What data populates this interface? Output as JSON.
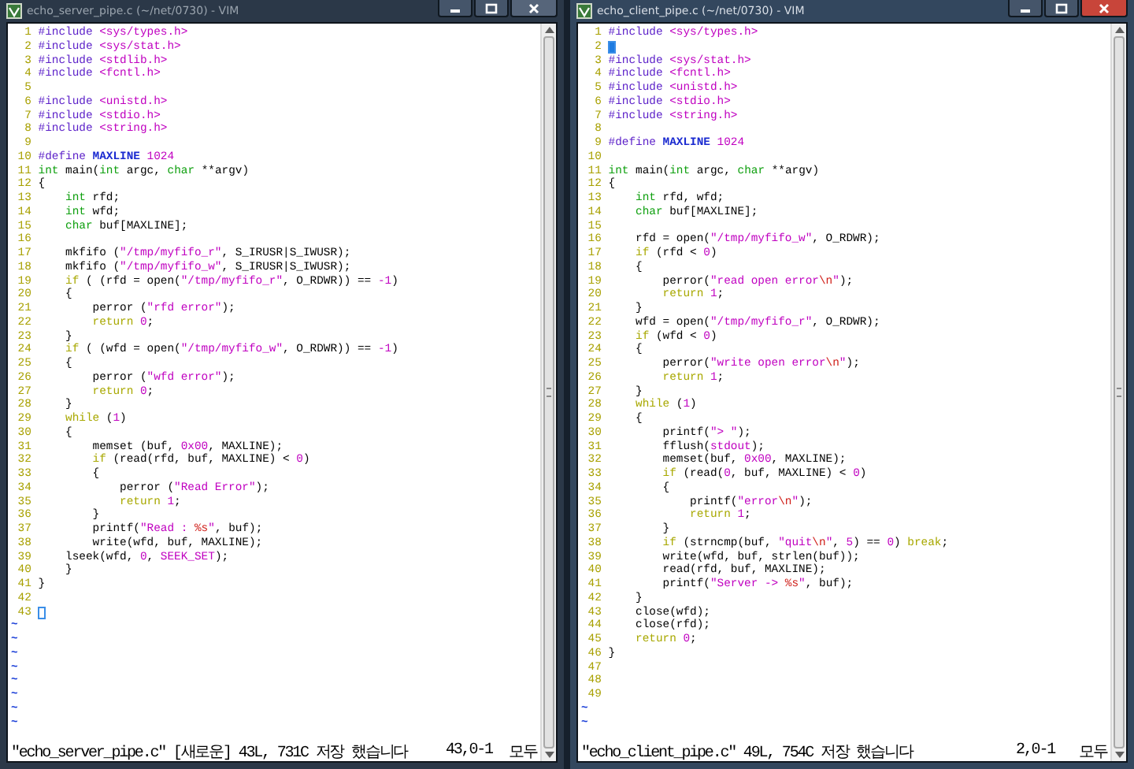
{
  "windows": [
    {
      "title": "echo_server_pipe.c (~/net/0730) - VIM",
      "active": false,
      "lines": [
        {
          "number": "1",
          "cursor": false,
          "tokens": [
            {
              "kind": "pre",
              "text": "#include "
            },
            {
              "kind": "inc",
              "text": "<sys/types.h>"
            }
          ]
        },
        {
          "number": "2",
          "cursor": false,
          "tokens": [
            {
              "kind": "pre",
              "text": "#include "
            },
            {
              "kind": "inc",
              "text": "<sys/stat.h>"
            }
          ]
        },
        {
          "number": "3",
          "cursor": false,
          "tokens": [
            {
              "kind": "pre",
              "text": "#include "
            },
            {
              "kind": "inc",
              "text": "<stdlib.h>"
            }
          ]
        },
        {
          "number": "4",
          "cursor": false,
          "tokens": [
            {
              "kind": "pre",
              "text": "#include "
            },
            {
              "kind": "inc",
              "text": "<fcntl.h>"
            }
          ]
        },
        {
          "number": "5",
          "cursor": false
        },
        {
          "number": "6",
          "cursor": false,
          "tokens": [
            {
              "kind": "pre",
              "text": "#include "
            },
            {
              "kind": "inc",
              "text": "<unistd.h>"
            }
          ]
        },
        {
          "number": "7",
          "cursor": false,
          "tokens": [
            {
              "kind": "pre",
              "text": "#include "
            },
            {
              "kind": "inc",
              "text": "<stdio.h>"
            }
          ]
        },
        {
          "number": "8",
          "cursor": false,
          "tokens": [
            {
              "kind": "pre",
              "text": "#include "
            },
            {
              "kind": "inc",
              "text": "<string.h>"
            }
          ]
        },
        {
          "number": "9",
          "cursor": false
        },
        {
          "number": "10",
          "cursor": false,
          "tokens": [
            {
              "kind": "pre",
              "text": "#define"
            },
            {
              "kind": "def",
              "text": " MAXLINE "
            },
            {
              "kind": "num",
              "text": "1024"
            }
          ]
        },
        {
          "number": "11",
          "cursor": false,
          "tokens": [
            {
              "kind": "type",
              "text": "int"
            },
            {
              "kind": "plain",
              "text": " main("
            },
            {
              "kind": "type",
              "text": "int"
            },
            {
              "kind": "plain",
              "text": " argc, "
            },
            {
              "kind": "type",
              "text": "char"
            },
            {
              "kind": "plain",
              "text": " **argv)"
            }
          ]
        },
        {
          "number": "12",
          "cursor": false,
          "tokens": [
            {
              "kind": "plain",
              "text": "{"
            }
          ]
        },
        {
          "number": "13",
          "cursor": false,
          "tokens": [
            {
              "kind": "type",
              "text": "    int"
            },
            {
              "kind": "plain",
              "text": " rfd;"
            }
          ]
        },
        {
          "number": "14",
          "cursor": false,
          "tokens": [
            {
              "kind": "type",
              "text": "    int"
            },
            {
              "kind": "plain",
              "text": " wfd;"
            }
          ]
        },
        {
          "number": "15",
          "cursor": false,
          "tokens": [
            {
              "kind": "type",
              "text": "    char"
            },
            {
              "kind": "plain",
              "text": " buf[MAXLINE];"
            }
          ]
        },
        {
          "number": "16",
          "cursor": false
        },
        {
          "number": "17",
          "cursor": false,
          "tokens": [
            {
              "kind": "plain",
              "text": "    mkfifo ("
            },
            {
              "kind": "str",
              "text": "\"/tmp/myfifo_r\""
            },
            {
              "kind": "plain",
              "text": ", S_IRUSR|S_IWUSR);"
            }
          ]
        },
        {
          "number": "18",
          "cursor": false,
          "tokens": [
            {
              "kind": "plain",
              "text": "    mkfifo ("
            },
            {
              "kind": "str",
              "text": "\"/tmp/myfifo_w\""
            },
            {
              "kind": "plain",
              "text": ", S_IRUSR|S_IWUSR);"
            }
          ]
        },
        {
          "number": "19",
          "cursor": false,
          "tokens": [
            {
              "kind": "stmt",
              "text": "    if"
            },
            {
              "kind": "plain",
              "text": " ( (rfd = open("
            },
            {
              "kind": "str",
              "text": "\"/tmp/myfifo_r\""
            },
            {
              "kind": "plain",
              "text": ", O_RDWR)) == "
            },
            {
              "kind": "num",
              "text": "-1"
            },
            {
              "kind": "plain",
              "text": ")"
            }
          ]
        },
        {
          "number": "20",
          "cursor": false,
          "tokens": [
            {
              "kind": "plain",
              "text": "    {"
            }
          ]
        },
        {
          "number": "21",
          "cursor": false,
          "tokens": [
            {
              "kind": "plain",
              "text": "        perror ("
            },
            {
              "kind": "str",
              "text": "\"rfd error\""
            },
            {
              "kind": "plain",
              "text": ");"
            }
          ]
        },
        {
          "number": "22",
          "cursor": false,
          "tokens": [
            {
              "kind": "stmt",
              "text": "        return "
            },
            {
              "kind": "num",
              "text": "0"
            },
            {
              "kind": "plain",
              "text": ";"
            }
          ]
        },
        {
          "number": "23",
          "cursor": false,
          "tokens": [
            {
              "kind": "plain",
              "text": "    }"
            }
          ]
        },
        {
          "number": "24",
          "cursor": false,
          "tokens": [
            {
              "kind": "stmt",
              "text": "    if"
            },
            {
              "kind": "plain",
              "text": " ( (wfd = open("
            },
            {
              "kind": "str",
              "text": "\"/tmp/myfifo_w\""
            },
            {
              "kind": "plain",
              "text": ", O_RDWR)) == "
            },
            {
              "kind": "num",
              "text": "-1"
            },
            {
              "kind": "plain",
              "text": ")"
            }
          ]
        },
        {
          "number": "25",
          "cursor": false,
          "tokens": [
            {
              "kind": "plain",
              "text": "    {"
            }
          ]
        },
        {
          "number": "26",
          "cursor": false,
          "tokens": [
            {
              "kind": "plain",
              "text": "        perror ("
            },
            {
              "kind": "str",
              "text": "\"wfd error\""
            },
            {
              "kind": "plain",
              "text": ");"
            }
          ]
        },
        {
          "number": "27",
          "cursor": false,
          "tokens": [
            {
              "kind": "stmt",
              "text": "        return "
            },
            {
              "kind": "num",
              "text": "0"
            },
            {
              "kind": "plain",
              "text": ";"
            }
          ]
        },
        {
          "number": "28",
          "cursor": false,
          "tokens": [
            {
              "kind": "plain",
              "text": "    }"
            }
          ]
        },
        {
          "number": "29",
          "cursor": false,
          "tokens": [
            {
              "kind": "stmt",
              "text": "    while"
            },
            {
              "kind": "plain",
              "text": " ("
            },
            {
              "kind": "num",
              "text": "1"
            },
            {
              "kind": "plain",
              "text": ")"
            }
          ]
        },
        {
          "number": "30",
          "cursor": false,
          "tokens": [
            {
              "kind": "plain",
              "text": "    {"
            }
          ]
        },
        {
          "number": "31",
          "cursor": false,
          "tokens": [
            {
              "kind": "plain",
              "text": "        memset (buf, "
            },
            {
              "kind": "num",
              "text": "0x00"
            },
            {
              "kind": "plain",
              "text": ", MAXLINE);"
            }
          ]
        },
        {
          "number": "32",
          "cursor": false,
          "tokens": [
            {
              "kind": "stmt",
              "text": "        if"
            },
            {
              "kind": "plain",
              "text": " (read(rfd, buf, MAXLINE) < "
            },
            {
              "kind": "num",
              "text": "0"
            },
            {
              "kind": "plain",
              "text": ")"
            }
          ]
        },
        {
          "number": "33",
          "cursor": false,
          "tokens": [
            {
              "kind": "plain",
              "text": "        {"
            }
          ]
        },
        {
          "number": "34",
          "cursor": false,
          "tokens": [
            {
              "kind": "plain",
              "text": "            perror ("
            },
            {
              "kind": "str",
              "text": "\"Read Error\""
            },
            {
              "kind": "plain",
              "text": ");"
            }
          ]
        },
        {
          "number": "35",
          "cursor": false,
          "tokens": [
            {
              "kind": "stmt",
              "text": "            return "
            },
            {
              "kind": "num",
              "text": "1"
            },
            {
              "kind": "plain",
              "text": ";"
            }
          ]
        },
        {
          "number": "36",
          "cursor": false,
          "tokens": [
            {
              "kind": "plain",
              "text": "        }"
            }
          ]
        },
        {
          "number": "37",
          "cursor": false,
          "tokens": [
            {
              "kind": "plain",
              "text": "        printf("
            },
            {
              "kind": "str",
              "text": "\"Read : "
            },
            {
              "kind": "esc",
              "text": "%s"
            },
            {
              "kind": "str",
              "text": "\""
            },
            {
              "kind": "plain",
              "text": ", buf);"
            }
          ]
        },
        {
          "number": "38",
          "cursor": false,
          "tokens": [
            {
              "kind": "plain",
              "text": "        write(wfd, buf, MAXLINE);"
            }
          ]
        },
        {
          "number": "39",
          "cursor": false,
          "tokens": [
            {
              "kind": "plain",
              "text": "    lseek(wfd, "
            },
            {
              "kind": "num",
              "text": "0"
            },
            {
              "kind": "plain",
              "text": ", "
            },
            {
              "kind": "const",
              "text": "SEEK_SET"
            },
            {
              "kind": "plain",
              "text": ");"
            }
          ]
        },
        {
          "number": "40",
          "cursor": false,
          "tokens": [
            {
              "kind": "plain",
              "text": "    }"
            }
          ]
        },
        {
          "number": "41",
          "cursor": false,
          "tokens": [
            {
              "kind": "plain",
              "text": "}"
            }
          ]
        },
        {
          "number": "42",
          "cursor": false
        },
        {
          "number": "43",
          "cursor": true
        }
      ],
      "tildes": [
        "~",
        "~",
        "~",
        "~",
        "~",
        "~",
        "~",
        "~"
      ],
      "status": {
        "message": "\"echo_server_pipe.c\" [새로운] 43L, 731C 저장 했습니다",
        "position": "43,0-1",
        "scroll": "모두"
      }
    },
    {
      "title": "echo_client_pipe.c (~/net/0730) - VIM",
      "active": true,
      "lines": [
        {
          "number": "1",
          "cursor": false,
          "tokens": [
            {
              "kind": "pre",
              "text": "#include "
            },
            {
              "kind": "inc",
              "text": "<sys/types.h>"
            }
          ]
        },
        {
          "number": "2",
          "cursor": true
        },
        {
          "number": "3",
          "cursor": false,
          "tokens": [
            {
              "kind": "pre",
              "text": "#include "
            },
            {
              "kind": "inc",
              "text": "<sys/stat.h>"
            }
          ]
        },
        {
          "number": "4",
          "cursor": false,
          "tokens": [
            {
              "kind": "pre",
              "text": "#include "
            },
            {
              "kind": "inc",
              "text": "<fcntl.h>"
            }
          ]
        },
        {
          "number": "5",
          "cursor": false,
          "tokens": [
            {
              "kind": "pre",
              "text": "#include "
            },
            {
              "kind": "inc",
              "text": "<unistd.h>"
            }
          ]
        },
        {
          "number": "6",
          "cursor": false,
          "tokens": [
            {
              "kind": "pre",
              "text": "#include "
            },
            {
              "kind": "inc",
              "text": "<stdio.h>"
            }
          ]
        },
        {
          "number": "7",
          "cursor": false,
          "tokens": [
            {
              "kind": "pre",
              "text": "#include "
            },
            {
              "kind": "inc",
              "text": "<string.h>"
            }
          ]
        },
        {
          "number": "8",
          "cursor": false
        },
        {
          "number": "9",
          "cursor": false,
          "tokens": [
            {
              "kind": "pre",
              "text": "#define"
            },
            {
              "kind": "def",
              "text": " MAXLINE "
            },
            {
              "kind": "num",
              "text": "1024"
            }
          ]
        },
        {
          "number": "10",
          "cursor": false
        },
        {
          "number": "11",
          "cursor": false,
          "tokens": [
            {
              "kind": "type",
              "text": "int"
            },
            {
              "kind": "plain",
              "text": " main("
            },
            {
              "kind": "type",
              "text": "int"
            },
            {
              "kind": "plain",
              "text": " argc, "
            },
            {
              "kind": "type",
              "text": "char"
            },
            {
              "kind": "plain",
              "text": " **argv)"
            }
          ]
        },
        {
          "number": "12",
          "cursor": false,
          "tokens": [
            {
              "kind": "plain",
              "text": "{"
            }
          ]
        },
        {
          "number": "13",
          "cursor": false,
          "tokens": [
            {
              "kind": "type",
              "text": "    int"
            },
            {
              "kind": "plain",
              "text": " rfd, wfd;"
            }
          ]
        },
        {
          "number": "14",
          "cursor": false,
          "tokens": [
            {
              "kind": "type",
              "text": "    char"
            },
            {
              "kind": "plain",
              "text": " buf[MAXLINE];"
            }
          ]
        },
        {
          "number": "15",
          "cursor": false
        },
        {
          "number": "16",
          "cursor": false,
          "tokens": [
            {
              "kind": "plain",
              "text": "    rfd = open("
            },
            {
              "kind": "str",
              "text": "\"/tmp/myfifo_w\""
            },
            {
              "kind": "plain",
              "text": ", O_RDWR);"
            }
          ]
        },
        {
          "number": "17",
          "cursor": false,
          "tokens": [
            {
              "kind": "stmt",
              "text": "    if"
            },
            {
              "kind": "plain",
              "text": " (rfd < "
            },
            {
              "kind": "num",
              "text": "0"
            },
            {
              "kind": "plain",
              "text": ")"
            }
          ]
        },
        {
          "number": "18",
          "cursor": false,
          "tokens": [
            {
              "kind": "plain",
              "text": "    {"
            }
          ]
        },
        {
          "number": "19",
          "cursor": false,
          "tokens": [
            {
              "kind": "plain",
              "text": "        perror("
            },
            {
              "kind": "str",
              "text": "\"read open error"
            },
            {
              "kind": "esc",
              "text": "\\n"
            },
            {
              "kind": "str",
              "text": "\""
            },
            {
              "kind": "plain",
              "text": ");"
            }
          ]
        },
        {
          "number": "20",
          "cursor": false,
          "tokens": [
            {
              "kind": "stmt",
              "text": "        return "
            },
            {
              "kind": "num",
              "text": "1"
            },
            {
              "kind": "plain",
              "text": ";"
            }
          ]
        },
        {
          "number": "21",
          "cursor": false,
          "tokens": [
            {
              "kind": "plain",
              "text": "    }"
            }
          ]
        },
        {
          "number": "22",
          "cursor": false,
          "tokens": [
            {
              "kind": "plain",
              "text": "    wfd = open("
            },
            {
              "kind": "str",
              "text": "\"/tmp/myfifo_r\""
            },
            {
              "kind": "plain",
              "text": ", O_RDWR);"
            }
          ]
        },
        {
          "number": "23",
          "cursor": false,
          "tokens": [
            {
              "kind": "stmt",
              "text": "    if"
            },
            {
              "kind": "plain",
              "text": " (wfd < "
            },
            {
              "kind": "num",
              "text": "0"
            },
            {
              "kind": "plain",
              "text": ")"
            }
          ]
        },
        {
          "number": "24",
          "cursor": false,
          "tokens": [
            {
              "kind": "plain",
              "text": "    {"
            }
          ]
        },
        {
          "number": "25",
          "cursor": false,
          "tokens": [
            {
              "kind": "plain",
              "text": "        perror("
            },
            {
              "kind": "str",
              "text": "\"write open error"
            },
            {
              "kind": "esc",
              "text": "\\n"
            },
            {
              "kind": "str",
              "text": "\""
            },
            {
              "kind": "plain",
              "text": ");"
            }
          ]
        },
        {
          "number": "26",
          "cursor": false,
          "tokens": [
            {
              "kind": "stmt",
              "text": "        return "
            },
            {
              "kind": "num",
              "text": "1"
            },
            {
              "kind": "plain",
              "text": ";"
            }
          ]
        },
        {
          "number": "27",
          "cursor": false,
          "tokens": [
            {
              "kind": "plain",
              "text": "    }"
            }
          ]
        },
        {
          "number": "28",
          "cursor": false,
          "tokens": [
            {
              "kind": "stmt",
              "text": "    while"
            },
            {
              "kind": "plain",
              "text": " ("
            },
            {
              "kind": "num",
              "text": "1"
            },
            {
              "kind": "plain",
              "text": ")"
            }
          ]
        },
        {
          "number": "29",
          "cursor": false,
          "tokens": [
            {
              "kind": "plain",
              "text": "    {"
            }
          ]
        },
        {
          "number": "30",
          "cursor": false,
          "tokens": [
            {
              "kind": "plain",
              "text": "        printf("
            },
            {
              "kind": "str",
              "text": "\"> \""
            },
            {
              "kind": "plain",
              "text": ");"
            }
          ]
        },
        {
          "number": "31",
          "cursor": false,
          "tokens": [
            {
              "kind": "plain",
              "text": "        fflush("
            },
            {
              "kind": "const",
              "text": "stdout"
            },
            {
              "kind": "plain",
              "text": ");"
            }
          ]
        },
        {
          "number": "32",
          "cursor": false,
          "tokens": [
            {
              "kind": "plain",
              "text": "        memset(buf, "
            },
            {
              "kind": "num",
              "text": "0x00"
            },
            {
              "kind": "plain",
              "text": ", MAXLINE);"
            }
          ]
        },
        {
          "number": "33",
          "cursor": false,
          "tokens": [
            {
              "kind": "stmt",
              "text": "        if"
            },
            {
              "kind": "plain",
              "text": " (read("
            },
            {
              "kind": "num",
              "text": "0"
            },
            {
              "kind": "plain",
              "text": ", buf, MAXLINE) < "
            },
            {
              "kind": "num",
              "text": "0"
            },
            {
              "kind": "plain",
              "text": ")"
            }
          ]
        },
        {
          "number": "34",
          "cursor": false,
          "tokens": [
            {
              "kind": "plain",
              "text": "        {"
            }
          ]
        },
        {
          "number": "35",
          "cursor": false,
          "tokens": [
            {
              "kind": "plain",
              "text": "            printf("
            },
            {
              "kind": "str",
              "text": "\"error"
            },
            {
              "kind": "esc",
              "text": "\\n"
            },
            {
              "kind": "str",
              "text": "\""
            },
            {
              "kind": "plain",
              "text": ");"
            }
          ]
        },
        {
          "number": "36",
          "cursor": false,
          "tokens": [
            {
              "kind": "stmt",
              "text": "            return "
            },
            {
              "kind": "num",
              "text": "1"
            },
            {
              "kind": "plain",
              "text": ";"
            }
          ]
        },
        {
          "number": "37",
          "cursor": false,
          "tokens": [
            {
              "kind": "plain",
              "text": "        }"
            }
          ]
        },
        {
          "number": "38",
          "cursor": false,
          "tokens": [
            {
              "kind": "stmt",
              "text": "        if"
            },
            {
              "kind": "plain",
              "text": " (strncmp(buf, "
            },
            {
              "kind": "str",
              "text": "\"quit"
            },
            {
              "kind": "esc",
              "text": "\\n"
            },
            {
              "kind": "str",
              "text": "\""
            },
            {
              "kind": "plain",
              "text": ", "
            },
            {
              "kind": "num",
              "text": "5"
            },
            {
              "kind": "plain",
              "text": ") == "
            },
            {
              "kind": "num",
              "text": "0"
            },
            {
              "kind": "plain",
              "text": ") "
            },
            {
              "kind": "stmt",
              "text": "break"
            },
            {
              "kind": "plain",
              "text": ";"
            }
          ]
        },
        {
          "number": "39",
          "cursor": false,
          "tokens": [
            {
              "kind": "plain",
              "text": "        write(wfd, buf, strlen(buf));"
            }
          ]
        },
        {
          "number": "40",
          "cursor": false,
          "tokens": [
            {
              "kind": "plain",
              "text": "        read(rfd, buf, MAXLINE);"
            }
          ]
        },
        {
          "number": "41",
          "cursor": false,
          "tokens": [
            {
              "kind": "plain",
              "text": "        printf("
            },
            {
              "kind": "str",
              "text": "\"Server -> "
            },
            {
              "kind": "esc",
              "text": "%s"
            },
            {
              "kind": "str",
              "text": "\""
            },
            {
              "kind": "plain",
              "text": ", buf);"
            }
          ]
        },
        {
          "number": "42",
          "cursor": false,
          "tokens": [
            {
              "kind": "plain",
              "text": "    }"
            }
          ]
        },
        {
          "number": "43",
          "cursor": false,
          "tokens": [
            {
              "kind": "plain",
              "text": "    close(wfd);"
            }
          ]
        },
        {
          "number": "44",
          "cursor": false,
          "tokens": [
            {
              "kind": "plain",
              "text": "    close(rfd);"
            }
          ]
        },
        {
          "number": "45",
          "cursor": false,
          "tokens": [
            {
              "kind": "stmt",
              "text": "    return "
            },
            {
              "kind": "num",
              "text": "0"
            },
            {
              "kind": "plain",
              "text": ";"
            }
          ]
        },
        {
          "number": "46",
          "cursor": false,
          "tokens": [
            {
              "kind": "plain",
              "text": "}"
            }
          ]
        },
        {
          "number": "47",
          "cursor": false
        },
        {
          "number": "48",
          "cursor": false
        },
        {
          "number": "49",
          "cursor": false
        }
      ],
      "tildes": [
        "~",
        "~"
      ],
      "status": {
        "message": "\"echo_client_pipe.c\" 49L, 754C 저장 했습니다",
        "position": "2,0-1",
        "scroll": "모두"
      }
    }
  ]
}
